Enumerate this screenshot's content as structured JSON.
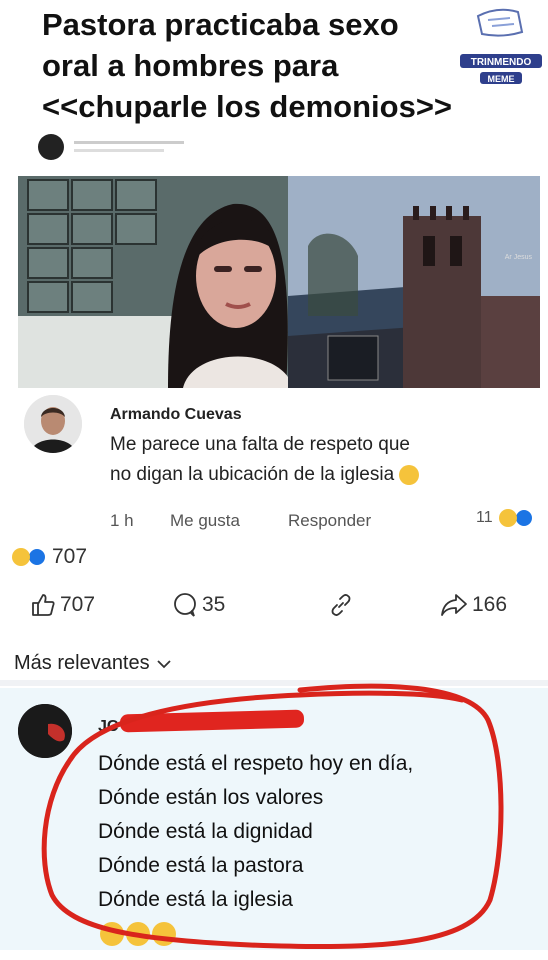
{
  "headline": {
    "line1": "Pastora practicaba sexo",
    "line2": "oral a hombres para",
    "line3": "<<chuparle los demonios>>"
  },
  "watermark": {
    "line1": "TRINMENDO",
    "line2": "MEME"
  },
  "photo": {
    "caption": "Ar Jesus"
  },
  "comment": {
    "author": "Armando Cuevas",
    "text_line1": "Me parece una falta de respeto que",
    "text_line2": "no digan la ubicación de la iglesia",
    "time": "1 h",
    "like_label": "Me gusta",
    "reply_label": "Responder",
    "reaction_count": "11"
  },
  "post_reactions": {
    "count": "707"
  },
  "stats": {
    "likes": "707",
    "comments": "35",
    "shares": "166"
  },
  "sort": {
    "label": "Más relevantes"
  },
  "reply": {
    "author_partial": "JC",
    "lines": [
      "Dónde está el respeto hoy en día,",
      "Dónde están los valores",
      "Dónde está  la dignidad",
      "Dónde está la pastora",
      "Dónde está la iglesia"
    ]
  },
  "colors": {
    "facebook_blue": "#1b74e4",
    "emoji_yellow": "#f5c33b",
    "highlight_red": "#e0251f",
    "reply_bg": "#eef7fb"
  }
}
